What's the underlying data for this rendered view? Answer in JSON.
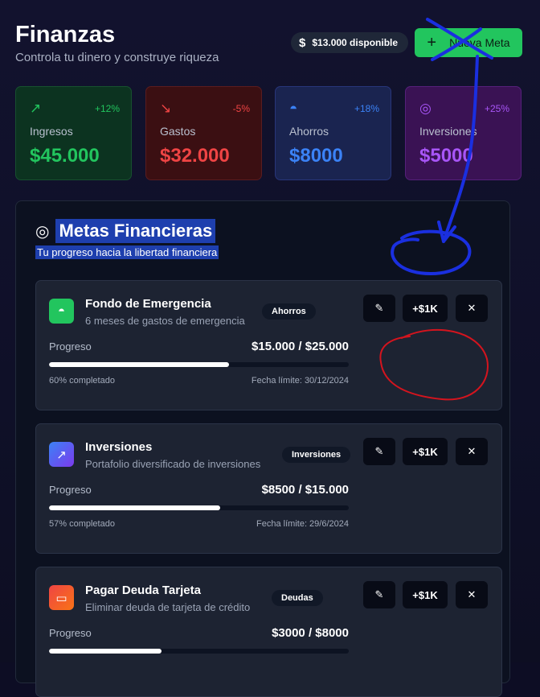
{
  "header": {
    "title": "Finanzas",
    "subtitle": "Controla tu dinero y construye riqueza",
    "balance_icon": "dollar-icon",
    "balance": "$13.000 disponible",
    "new_goal_icon": "plus-icon",
    "new_goal_label": "Nueva Meta"
  },
  "stats": [
    {
      "icon": "trending-up-icon",
      "glyph": "↗",
      "label": "Ingresos",
      "value": "$45.000",
      "change": "+12%",
      "color": "#22c55e"
    },
    {
      "icon": "trending-down-icon",
      "glyph": "↘",
      "label": "Gastos",
      "value": "$32.000",
      "change": "-5%",
      "color": "#ef4444"
    },
    {
      "icon": "piggy-bank-icon",
      "glyph": "◓",
      "label": "Ahorros",
      "value": "$8000",
      "change": "+18%",
      "color": "#3b82f6"
    },
    {
      "icon": "target-icon",
      "glyph": "◎",
      "label": "Inversiones",
      "value": "$5000",
      "change": "+25%",
      "color": "#a855f7"
    }
  ],
  "goals_panel": {
    "title": "Metas Financieras",
    "subtitle": "Tu progreso hacia la libertad financiera",
    "title_icon": "target-icon"
  },
  "goals": [
    {
      "title": "Fondo de Emergencia",
      "description": "6 meses de gastos de emergencia",
      "tag": "Ahorros",
      "icon": "piggy-bank-icon",
      "glyph": "◓",
      "icon_color": "#22c55e",
      "progress_label": "Progreso",
      "amount": "$15.000 / $25.000",
      "progress": 0.6,
      "completed": "60% completado",
      "deadline": "Fecha límite: 30/12/2024",
      "add_label": "+$1K",
      "edit_icon": "edit-icon",
      "delete_icon": "close-icon"
    },
    {
      "title": "Inversiones",
      "description": "Portafolio diversificado de inversiones",
      "tag": "Inversiones",
      "icon": "trending-up-icon",
      "glyph": "↗",
      "icon_color": "#6366f1",
      "progress_label": "Progreso",
      "amount": "$8500 / $15.000",
      "progress": 0.57,
      "completed": "57% completado",
      "deadline": "Fecha límite: 29/6/2024",
      "add_label": "+$1K",
      "edit_icon": "edit-icon",
      "delete_icon": "close-icon"
    },
    {
      "title": "Pagar Deuda Tarjeta",
      "description": "Eliminar deuda de tarjeta de crédito",
      "tag": "Deudas",
      "icon": "credit-card-icon",
      "glyph": "▭",
      "icon_color": "#ef4444",
      "progress_label": "Progreso",
      "amount": "$3000 / $8000",
      "progress": 0.375,
      "completed": "",
      "deadline": "",
      "add_label": "+$1K",
      "edit_icon": "edit-icon",
      "delete_icon": "close-icon"
    }
  ],
  "annotations": {
    "blue_color": "#1a2fe0",
    "red_color": "#d4141e"
  }
}
